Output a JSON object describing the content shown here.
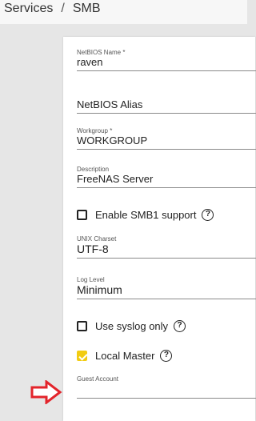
{
  "breadcrumb": {
    "parent": "Services",
    "separator": "/",
    "current": "SMB"
  },
  "form": {
    "netbios_name": {
      "label": "NetBIOS Name *",
      "value": "raven"
    },
    "netbios_alias": {
      "placeholder": "NetBIOS Alias"
    },
    "workgroup": {
      "label": "Workgroup *",
      "value": "WORKGROUP"
    },
    "description": {
      "label": "Description",
      "value": "FreeNAS Server"
    },
    "enable_smb1": {
      "label": "Enable SMB1 support",
      "checked": false,
      "help": "?"
    },
    "unix_charset": {
      "label": "UNIX Charset",
      "value": "UTF-8"
    },
    "log_level": {
      "label": "Log Level",
      "value": "Minimum"
    },
    "use_syslog": {
      "label": "Use syslog only",
      "checked": false,
      "help": "?"
    },
    "local_master": {
      "label": "Local Master",
      "checked": true,
      "help": "?"
    },
    "guest_account": {
      "label": "Guest Account",
      "value": ""
    }
  },
  "colors": {
    "checkbox_checked": "#f2cc12",
    "annotation_arrow": "#e3242b"
  },
  "icons": {
    "help": "help-circle-icon",
    "annotation": "arrow-right-icon"
  }
}
